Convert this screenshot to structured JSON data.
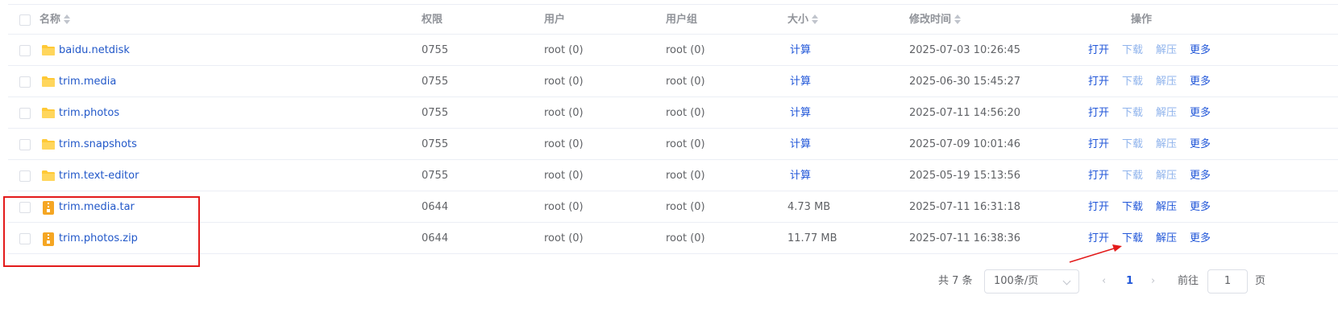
{
  "header": {
    "name": "名称",
    "perm": "权限",
    "user": "用户",
    "group": "用户组",
    "size": "大小",
    "mtime": "修改时间",
    "ops": "操作"
  },
  "rows": [
    {
      "name": "baidu.netdisk",
      "type": "folder",
      "perm": "0755",
      "user": "root (0)",
      "group": "root (0)",
      "size": "计算",
      "mtime": "2025-07-03 10:26:45"
    },
    {
      "name": "trim.media",
      "type": "folder",
      "perm": "0755",
      "user": "root (0)",
      "group": "root (0)",
      "size": "计算",
      "mtime": "2025-06-30 15:45:27"
    },
    {
      "name": "trim.photos",
      "type": "folder",
      "perm": "0755",
      "user": "root (0)",
      "group": "root (0)",
      "size": "计算",
      "mtime": "2025-07-11 14:56:20"
    },
    {
      "name": "trim.snapshots",
      "type": "folder",
      "perm": "0755",
      "user": "root (0)",
      "group": "root (0)",
      "size": "计算",
      "mtime": "2025-07-09 10:01:46"
    },
    {
      "name": "trim.text-editor",
      "type": "folder",
      "perm": "0755",
      "user": "root (0)",
      "group": "root (0)",
      "size": "计算",
      "mtime": "2025-05-19 15:13:56"
    },
    {
      "name": "trim.media.tar",
      "type": "archive",
      "perm": "0644",
      "user": "root (0)",
      "group": "root (0)",
      "size": "4.73 MB",
      "mtime": "2025-07-11 16:31:18"
    },
    {
      "name": "trim.photos.zip",
      "type": "archive",
      "perm": "0644",
      "user": "root (0)",
      "group": "root (0)",
      "size": "11.77 MB",
      "mtime": "2025-07-11 16:38:36"
    }
  ],
  "actions": {
    "open": "打开",
    "download": "下载",
    "extract": "解压",
    "more": "更多"
  },
  "pagination": {
    "total": "共 7 条",
    "page_size": "100条/页",
    "current_page": "1",
    "goto_label": "前往",
    "goto_value": "1",
    "page_suffix": "页"
  },
  "colors": {
    "link": "#2056d8",
    "muted_link": "#8fb3ec",
    "folder": "#ffc936",
    "archive": "#f5a623",
    "annotation": "#e31b1b"
  }
}
